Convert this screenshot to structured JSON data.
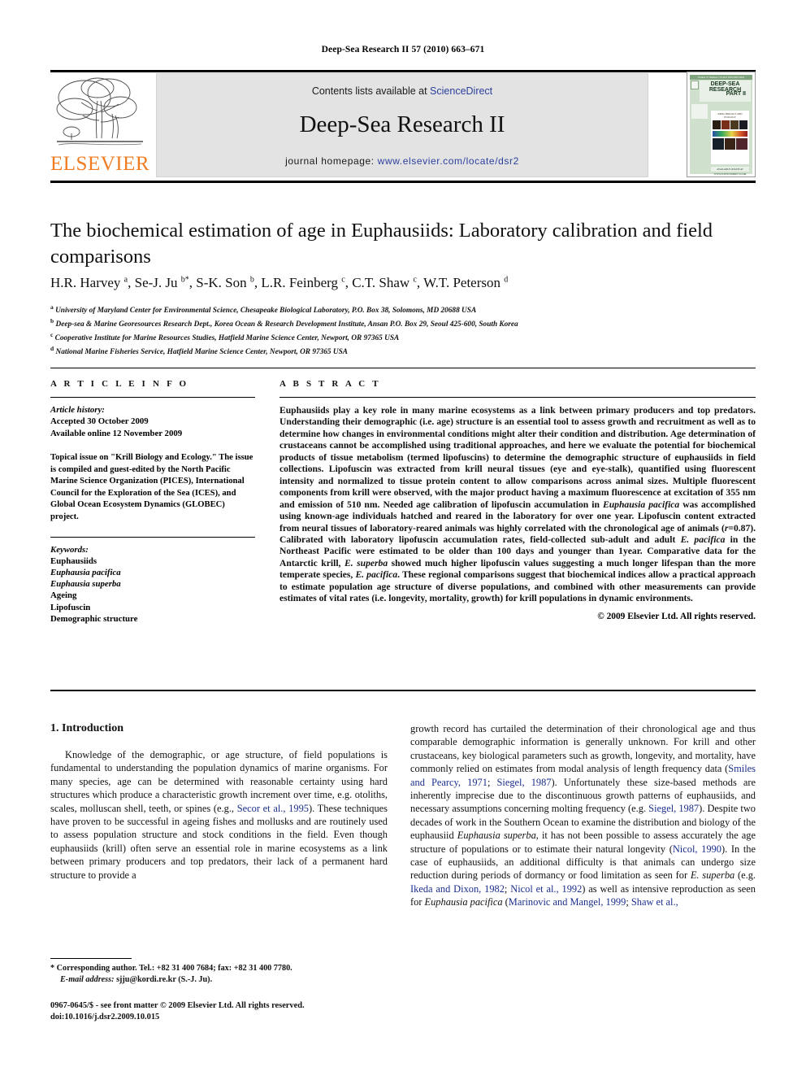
{
  "running_head": "Deep-Sea Research II 57 (2010) 663–671",
  "masthead": {
    "contents_prefix": "Contents lists available at ",
    "sciencedirect": "ScienceDirect",
    "journal_title": "Deep-Sea Research II",
    "homepage_prefix": "journal homepage: ",
    "homepage_url": "www.elsevier.com/locate/dsr2",
    "publisher": "ELSEVIER",
    "publisher_color": "#F07C22",
    "link_color": "#2b3f9e"
  },
  "cover": {
    "line1": "DEEP-SEA RESEARCH",
    "line2": "PART II",
    "topbar": "Volume 57   Numbers 7-8   2010   ISSN 0967-0645",
    "caption": "KRILL BIOLOGY AND ECOLOGY",
    "footer": "AVAILABLE ONLINE AT WWW.SCIENCEDIRECT.COM"
  },
  "article": {
    "title": "The biochemical estimation of age in Euphausiids: Laboratory calibration and field comparisons",
    "authors": "H.R. Harvey a, Se-J. Ju b*, S-K. Son b, L.R. Feinberg c, C.T. Shaw c, W.T. Peterson d",
    "affiliations": [
      {
        "mark": "a",
        "text": "University of Maryland Center for Environmental Science, Chesapeake Biological Laboratory, P.O. Box 38, Solomons, MD 20688 USA"
      },
      {
        "mark": "b",
        "text": "Deep-sea & Marine Georesources Research Dept., Korea Ocean & Research Development Institute, Ansan P.O. Box 29, Seoul 425-600, South Korea"
      },
      {
        "mark": "c",
        "text": "Cooperative Institute for Marine Resources Studies, Hatfield Marine Science Center, Newport, OR 97365 USA"
      },
      {
        "mark": "d",
        "text": "National Marine Fisheries Service, Hatfield Marine Science Center, Newport, OR 97365 USA"
      }
    ]
  },
  "article_info": {
    "heading": "A R T I C L E   I N F O",
    "history_label": "Article history:",
    "history": [
      "Accepted 30 October 2009",
      "Available online 12 November 2009"
    ],
    "topical_issue": "Topical issue on \"Krill Biology and Ecology.\" The issue is compiled and guest-edited by the North Pacific Marine Science Organization (PICES), International Council for the Exploration of the Sea (ICES), and Global Ocean Ecosystem Dynamics (GLOBEC) project.",
    "keywords_label": "Keywords:",
    "keywords": [
      {
        "text": "Euphausiids",
        "italic": false
      },
      {
        "text": "Euphausia pacifica",
        "italic": true
      },
      {
        "text": "Euphausia superba",
        "italic": true
      },
      {
        "text": "Ageing",
        "italic": false
      },
      {
        "text": "Lipofuscin",
        "italic": false
      },
      {
        "text": "Demographic structure",
        "italic": false
      }
    ]
  },
  "abstract": {
    "heading": "A B S T R A C T",
    "body_html": "Euphausiids play a key role in many marine ecosystems as a link between primary producers and top predators. Understanding their demographic (i.e. age) structure is an essential tool to assess growth and recruitment as well as to determine how changes in environmental conditions might alter their condition and distribution. Age determination of crustaceans cannot be accomplished using traditional approaches, and here we evaluate the potential for biochemical products of tissue metabolism (termed lipofuscins) to determine the demographic structure of euphausiids in field collections. Lipofuscin was extracted from krill neural tissues (eye and eye-stalk), quantified using fluorescent intensity and normalized to tissue protein content to allow comparisons across animal sizes. Multiple fluorescent components from krill were observed, with the major product having a maximum fluorescence at excitation of 355 nm and emission of 510 nm. Needed age calibration of lipofuscin accumulation in <i>Euphausia pacifica</i> was accomplished using known-age individuals hatched and reared in the laboratory for over one year. Lipofuscin content extracted from neural tissues of laboratory-reared animals was highly correlated with the chronological age of animals (<i>r</i>=0.87). Calibrated with laboratory lipofuscin accumulation rates, field-collected sub-adult and adult <i>E. pacifica</i> in the Northeast Pacific were estimated to be older than 100 days and younger than 1year. Comparative data for the Antarctic krill, <i>E. superba</i> showed much higher lipofuscin values suggesting a much longer lifespan than the more temperate species, <i>E. pacifica</i>. These regional comparisons suggest that biochemical indices allow a practical approach to estimate population age structure of diverse populations, and combined with other measurements can provide estimates of vital rates (i.e. longevity, mortality, growth) for krill populations in dynamic environments.",
    "copyright": "© 2009 Elsevier Ltd. All rights reserved."
  },
  "introduction": {
    "heading": "1.  Introduction",
    "left_html": "Knowledge of the demographic, or age structure, of field populations is fundamental to understanding the population dynamics of marine organisms. For many species, age can be determined with reasonable certainty using hard structures which produce a characteristic growth increment over time, e.g. otoliths, scales, molluscan shell, teeth, or spines (e.g., <span class=\"cite\">Secor et al., 1995</span>). These techniques have proven to be successful in ageing fishes and mollusks and are routinely used to assess population structure and stock conditions in the field. Even though euphausiids (krill) often serve an essential role in marine ecosystems as a link between primary producers and top predators, their lack of a permanent hard structure to provide a",
    "right_html": "growth record has curtailed the determination of their chronological age and thus comparable demographic information is generally unknown. For krill and other crustaceans, key biological parameters such as growth, longevity, and mortality, have commonly relied on estimates from modal analysis of length frequency data (<span class=\"cite\">Smiles and Pearcy, 1971</span>; <span class=\"cite\">Siegel, 1987</span>). Unfortunately these size-based methods are inherently imprecise due to the discontinuous growth patterns of euphausiids, and necessary assumptions concerning molting frequency (e.g. <span class=\"cite\">Siegel, 1987</span>). Despite two decades of work in the Southern Ocean to examine the distribution and biology of the euphausiid <i>Euphausia superba</i>, it has not been possible to assess accurately the age structure of populations or to estimate their natural longevity (<span class=\"cite\">Nicol, 1990</span>). In the case of euphausiids, an additional difficulty is that animals can undergo size reduction during periods of dormancy or food limitation as seen for <i>E. superba</i> (e.g. <span class=\"cite\">Ikeda and Dixon, 1982</span>; <span class=\"cite\">Nicol et al., 1992</span>) as well as intensive reproduction as seen for <i>Euphausia pacifica</i> (<span class=\"cite\">Marinovic and Mangel, 1999</span>; <span class=\"cite\">Shaw et al.,</span>"
  },
  "footnote": {
    "corresponding": "* Corresponding author. Tel.: +82 31 400 7684; fax: +82 31 400 7780.",
    "email_label": "E-mail address:",
    "email": "sjju@kordi.re.kr (S.-J. Ju)."
  },
  "imprint": {
    "line1": "0967-0645/$ - see front matter © 2009 Elsevier Ltd. All rights reserved.",
    "line2": "doi:10.1016/j.dsr2.2009.10.015"
  }
}
